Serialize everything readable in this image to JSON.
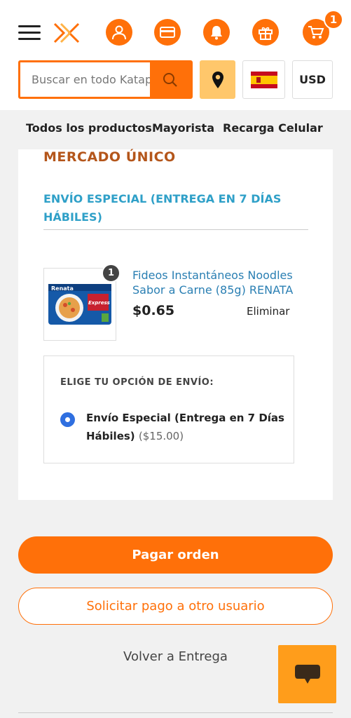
{
  "header": {
    "cart_count": "1",
    "search": {
      "placeholder": "Buscar en todo Katapulk"
    },
    "currency": "USD",
    "icons": [
      "menu-icon",
      "logo",
      "user-icon",
      "card-icon",
      "bell-icon",
      "gift-icon",
      "cart-icon",
      "search-icon",
      "location-pin-icon",
      "spain-flag-icon"
    ]
  },
  "nav": {
    "items": [
      "Todos los productos",
      "Mayorista",
      "Recarga Celular"
    ]
  },
  "order": {
    "seller": "MERCADO ÚNICO",
    "shipping_group": "ENVÍO ESPECIAL (ENTREGA EN 7 DÍAS HÁBILES)",
    "item": {
      "quantity": "1",
      "name": "Fideos Instantáneos Noodles Sabor a Carne (85g) RENATA",
      "price": "$0.65",
      "remove_label": "Eliminar",
      "package_brand": "Renata",
      "package_line": "Express"
    },
    "shipping": {
      "label": "ELIGE TU OPCIÓN DE ENVÍO:",
      "option_name": "Envío Especial (Entrega en 7 Días Hábiles)",
      "option_price": "($15.00)"
    }
  },
  "actions": {
    "pay": "Pagar orden",
    "request": "Solicitar pago a otro usuario",
    "back": "Volver a Entrega"
  },
  "colors": {
    "accent": "#ff7009",
    "seller_title": "#b4561b",
    "link": "#2fa0c8",
    "radio": "#2f6fe0",
    "chat": "#ff9d1b",
    "location_button": "#ffc76b"
  }
}
